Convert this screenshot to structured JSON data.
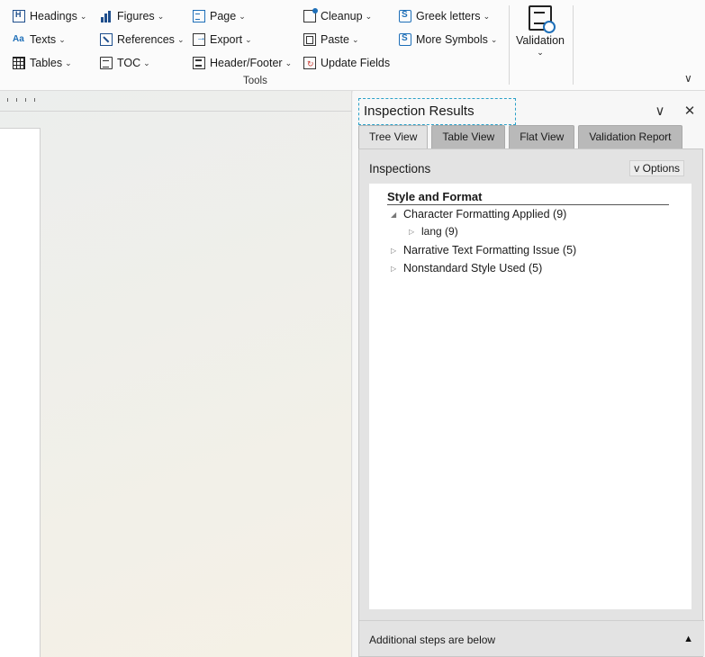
{
  "ribbon": {
    "col1": [
      {
        "label": "Headings",
        "icon": "heading-icon"
      },
      {
        "label": "Texts",
        "icon": "text-style-icon"
      },
      {
        "label": "Tables",
        "icon": "table-icon"
      }
    ],
    "col2": [
      {
        "label": "Figures",
        "icon": "bar-chart-icon"
      },
      {
        "label": "References",
        "icon": "references-icon"
      },
      {
        "label": "TOC",
        "icon": "toc-icon"
      }
    ],
    "col3": [
      {
        "label": "Page",
        "icon": "page-icon"
      },
      {
        "label": "Export",
        "icon": "export-icon"
      },
      {
        "label": "Header/Footer",
        "icon": "header-footer-icon"
      }
    ],
    "col4": [
      {
        "label": "Cleanup",
        "icon": "cleanup-icon"
      },
      {
        "label": "Paste",
        "icon": "paste-icon"
      },
      {
        "label": "Update Fields",
        "icon": "update-fields-icon"
      }
    ],
    "col5": [
      {
        "label": "Greek letters",
        "icon": "symbol-icon"
      },
      {
        "label": "More Symbols",
        "icon": "symbol-icon"
      }
    ],
    "group_label": "Tools",
    "validation_label": "Validation",
    "chevron": "⌄",
    "collapse_glyph": "∨"
  },
  "panel": {
    "title": "Inspection Results",
    "collapse_glyph": "∨",
    "close_glyph": "✕",
    "tabs": [
      "Tree View",
      "Table View",
      "Flat View",
      "Validation Report"
    ],
    "active_tab": "Tree View",
    "inspections_label": "Inspections",
    "options_label": "v Options",
    "tree": {
      "title": "Style and Format",
      "nodes": [
        {
          "label": "Character Formatting Applied (9)",
          "expanded": true,
          "toggle": "◢"
        },
        {
          "label": "lang (9)",
          "expanded": false,
          "toggle": "▷"
        },
        {
          "label": "Narrative Text Formatting Issue (5)",
          "expanded": false,
          "toggle": "▷"
        },
        {
          "label": "Nonstandard Style Used (5)",
          "expanded": false,
          "toggle": "▷"
        }
      ]
    },
    "footer": {
      "text": "Additional steps are below",
      "button": "▲"
    }
  }
}
